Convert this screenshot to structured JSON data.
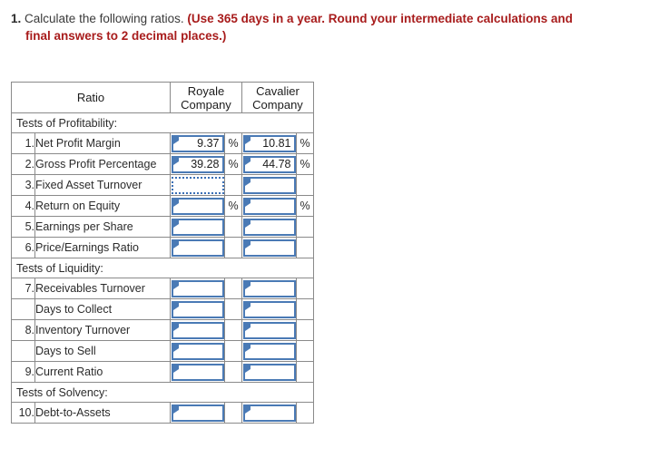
{
  "question": {
    "number": "1.",
    "text": "Calculate the following ratios.",
    "note_line1": "(Use 365 days in a year. Round your intermediate calculations and",
    "note_line2": "final answers to 2 decimal places.)",
    "note_color": "#a81c1c"
  },
  "table": {
    "header": {
      "ratio": "Ratio",
      "royale": "Royale\nCompany",
      "royale_line1": "Royale",
      "royale_line2": "Company",
      "cavalier_line1": "Cavalier",
      "cavalier_line2": "Company",
      "background_color": "#7ba7dc"
    },
    "sections": [
      {
        "title": "Tests of Profitability:"
      },
      {
        "title": "Tests of Liquidity:"
      },
      {
        "title": "Tests of Solvency:"
      }
    ],
    "rows": [
      {
        "section": "Tests of Profitability:",
        "num": "1.",
        "label": "Net Profit Margin",
        "royale_value": "9.37",
        "royale_suffix": "%",
        "royale_focused": false,
        "cavalier_value": "10.81",
        "cavalier_suffix": "%",
        "cavalier_focused": false
      },
      {
        "section": "Tests of Profitability:",
        "num": "2.",
        "label": "Gross Profit Percentage",
        "royale_value": "39.28",
        "royale_suffix": "%",
        "royale_focused": false,
        "cavalier_value": "44.78",
        "cavalier_suffix": "%",
        "cavalier_focused": false
      },
      {
        "section": "Tests of Profitability:",
        "num": "3.",
        "label": "Fixed Asset Turnover",
        "royale_value": "",
        "royale_suffix": "",
        "royale_focused": true,
        "cavalier_value": "",
        "cavalier_suffix": "",
        "cavalier_focused": false
      },
      {
        "section": "Tests of Profitability:",
        "num": "4.",
        "label": "Return on Equity",
        "royale_value": "",
        "royale_suffix": "%",
        "royale_focused": false,
        "cavalier_value": "",
        "cavalier_suffix": "%",
        "cavalier_focused": false
      },
      {
        "section": "Tests of Profitability:",
        "num": "5.",
        "label": "Earnings per Share",
        "royale_value": "",
        "royale_suffix": "",
        "royale_focused": false,
        "cavalier_value": "",
        "cavalier_suffix": "",
        "cavalier_focused": false
      },
      {
        "section": "Tests of Profitability:",
        "num": "6.",
        "label": "Price/Earnings Ratio",
        "royale_value": "",
        "royale_suffix": "",
        "royale_focused": false,
        "cavalier_value": "",
        "cavalier_suffix": "",
        "cavalier_focused": false
      },
      {
        "section": "Tests of Liquidity:",
        "num": "7.",
        "label": "Receivables Turnover",
        "royale_value": "",
        "royale_suffix": "",
        "royale_focused": false,
        "cavalier_value": "",
        "cavalier_suffix": "",
        "cavalier_focused": false
      },
      {
        "section": "Tests of Liquidity:",
        "num": "",
        "label": "Days to Collect",
        "royale_value": "",
        "royale_suffix": "",
        "royale_focused": false,
        "cavalier_value": "",
        "cavalier_suffix": "",
        "cavalier_focused": false
      },
      {
        "section": "Tests of Liquidity:",
        "num": "8.",
        "label": "Inventory Turnover",
        "royale_value": "",
        "royale_suffix": "",
        "royale_focused": false,
        "cavalier_value": "",
        "cavalier_suffix": "",
        "cavalier_focused": false
      },
      {
        "section": "Tests of Liquidity:",
        "num": "",
        "label": "Days to Sell",
        "royale_value": "",
        "royale_suffix": "",
        "royale_focused": false,
        "cavalier_value": "",
        "cavalier_suffix": "",
        "cavalier_focused": false
      },
      {
        "section": "Tests of Liquidity:",
        "num": "9.",
        "label": "Current Ratio",
        "royale_value": "",
        "royale_suffix": "",
        "royale_focused": false,
        "cavalier_value": "",
        "cavalier_suffix": "",
        "cavalier_focused": false
      },
      {
        "section": "Tests of Solvency:",
        "num": "10.",
        "label": "Debt-to-Assets",
        "royale_value": "",
        "royale_suffix": "",
        "royale_focused": false,
        "cavalier_value": "",
        "cavalier_suffix": "",
        "cavalier_focused": false
      }
    ]
  }
}
